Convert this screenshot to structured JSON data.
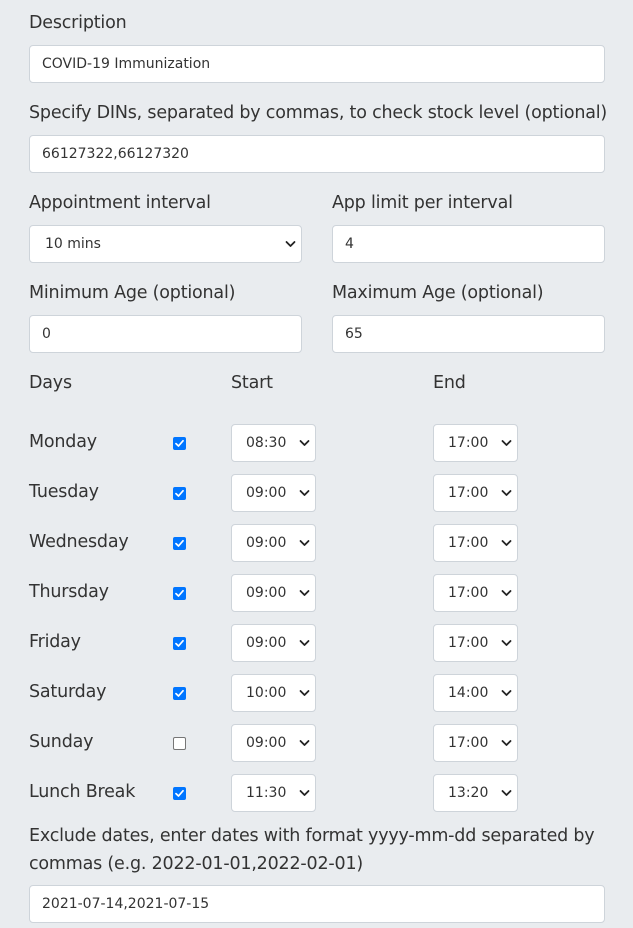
{
  "description": {
    "label": "Description",
    "value": "COVID-19 Immunization"
  },
  "dins": {
    "label": "Specify DINs, separated by commas, to check stock level (optional)",
    "value": "66127322,66127320"
  },
  "appointment_interval": {
    "label": "Appointment interval",
    "selected": "10 mins"
  },
  "app_limit": {
    "label": "App limit per interval",
    "value": "4"
  },
  "min_age": {
    "label": "Minimum Age (optional)",
    "value": "0"
  },
  "max_age": {
    "label": "Maximum Age (optional)",
    "value": "65"
  },
  "schedule": {
    "headers": {
      "days": "Days",
      "start": "Start",
      "end": "End"
    },
    "rows": [
      {
        "day": "Monday",
        "checked": true,
        "start": "08:30",
        "end": "17:00"
      },
      {
        "day": "Tuesday",
        "checked": true,
        "start": "09:00",
        "end": "17:00"
      },
      {
        "day": "Wednesday",
        "checked": true,
        "start": "09:00",
        "end": "17:00"
      },
      {
        "day": "Thursday",
        "checked": true,
        "start": "09:00",
        "end": "17:00"
      },
      {
        "day": "Friday",
        "checked": true,
        "start": "09:00",
        "end": "17:00"
      },
      {
        "day": "Saturday",
        "checked": true,
        "start": "10:00",
        "end": "14:00"
      },
      {
        "day": "Sunday",
        "checked": false,
        "start": "09:00",
        "end": "17:00"
      },
      {
        "day": "Lunch Break",
        "checked": true,
        "start": "11:30",
        "end": "13:20"
      }
    ]
  },
  "exclude_dates": {
    "label_line1": "Exclude dates, enter dates with format yyyy-mm-dd separated by",
    "label_line2": "commas (e.g. 2022-01-01,2022-02-01)",
    "value": "2021-07-14,2021-07-15"
  },
  "colors": {
    "accent": "#0075ff",
    "background": "#e9ecef",
    "border": "#ced4da"
  },
  "icons": {
    "select_arrow": "chevron-down-icon",
    "checkbox_mark": "check-icon"
  }
}
